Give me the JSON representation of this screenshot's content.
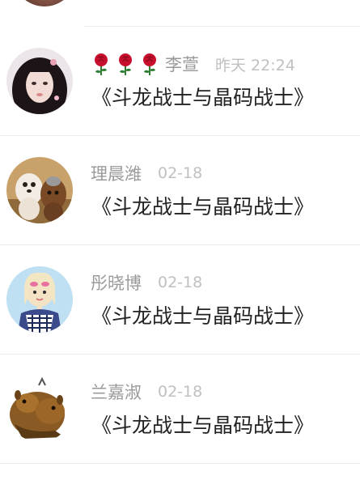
{
  "comments": [
    {
      "rose_icons": [
        "rose-icon",
        "rose-icon",
        "rose-icon"
      ],
      "name": "李萱",
      "time": "昨天 22:24",
      "message": "《斗龙战士与晶码战士》"
    },
    {
      "name": "理晨潍",
      "time": "02-18",
      "message": "《斗龙战士与晶码战士》"
    },
    {
      "name": "彤晓博",
      "time": "02-18",
      "message": "《斗龙战士与晶码战士》"
    },
    {
      "name": "兰嘉淑",
      "time": "02-18",
      "message": "《斗龙战士与晶码战士》"
    }
  ],
  "colors": {
    "name": "#9a9a9a",
    "time": "#c0c0c0",
    "message": "#222222",
    "divider": "#ececec",
    "rose": "#c8102e"
  }
}
